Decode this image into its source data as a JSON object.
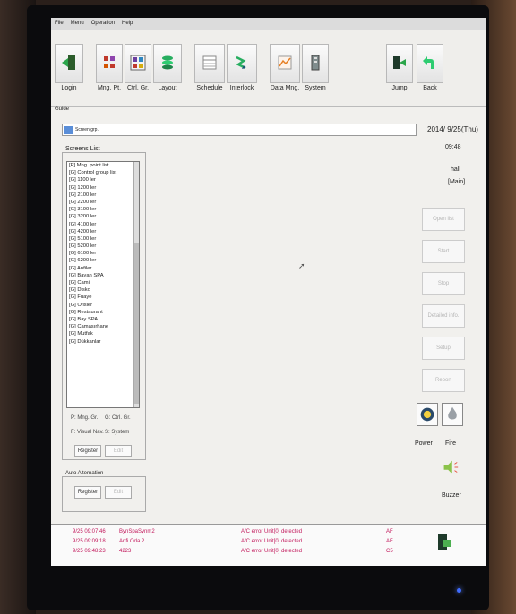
{
  "menu": [
    "File",
    "Menu",
    "Operation",
    "Help"
  ],
  "toolbar": {
    "login": "Login",
    "mng_pt": "Mng. Pt.",
    "ctrl_gr": "Ctrl. Gr.",
    "layout": "Layout",
    "schedule": "Schedule",
    "interlock": "Interlock",
    "data_mng": "Data Mng.",
    "system": "System",
    "jump": "Jump",
    "back": "Back"
  },
  "guide": "Guide",
  "screen_bar_label": "Screen grp.",
  "header": {
    "date": "2014/ 9/25(Thu)",
    "time": "09:48",
    "location": "hall",
    "mode": "[Main]"
  },
  "screens_list": {
    "title": "Screens List",
    "items": [
      "[P] Mng. point list",
      "[G] Control group list",
      "[G] 1100 ler",
      "[G] 1200 ler",
      "[G] 2100 ler",
      "[G] 2200 ler",
      "[G] 3100 ler",
      "[G] 3200 ler",
      "[G] 4100 ler",
      "[G] 4200 ler",
      "[G] 5100 ler",
      "[G] 5200 ler",
      "[G] 6100 ler",
      "[G] 6200 ler",
      "[G] Anfiler",
      "[G] Bayan SPA",
      "[G] Cami",
      "[G] Disko",
      "[G] Fuaye",
      "[G] Ofisler",
      "[G] Restaurant",
      "[G] Bay SPA",
      "[G] Çamaşırhane",
      "[G] Mutfak",
      "[G] Dükkanlar"
    ],
    "legend": [
      "P: Mng. Gr.",
      "G: Ctrl. Gr.",
      "F: Visual Nav.",
      "S: System"
    ],
    "register": "Register",
    "edit": "Edit"
  },
  "auto_alternation": {
    "title": "Auto Alternation",
    "register": "Register",
    "edit": "Edit"
  },
  "side_buttons": [
    "Open list",
    "Start",
    "Stop",
    "Detailed info.",
    "Setup",
    "Report"
  ],
  "indicators": {
    "power": "Power",
    "fire": "Fire",
    "buzzer": "Buzzer"
  },
  "log": [
    {
      "time": "9/25 09:07:46",
      "source": "BynSpaSynm2",
      "message": "A/C error Unit[0] detected",
      "code": "AF"
    },
    {
      "time": "9/25 09:09:18",
      "source": "Anfi Oda 2",
      "message": "A/C error Unit[0] detected",
      "code": "AF"
    },
    {
      "time": "9/25 09:48:23",
      "source": "4223",
      "message": "A/C error Unit[0] detected",
      "code": "C5"
    }
  ],
  "colors": {
    "log_text": "#c2185b",
    "accent_blue": "#3d6fd1",
    "bezel": "#0b0b0d"
  }
}
